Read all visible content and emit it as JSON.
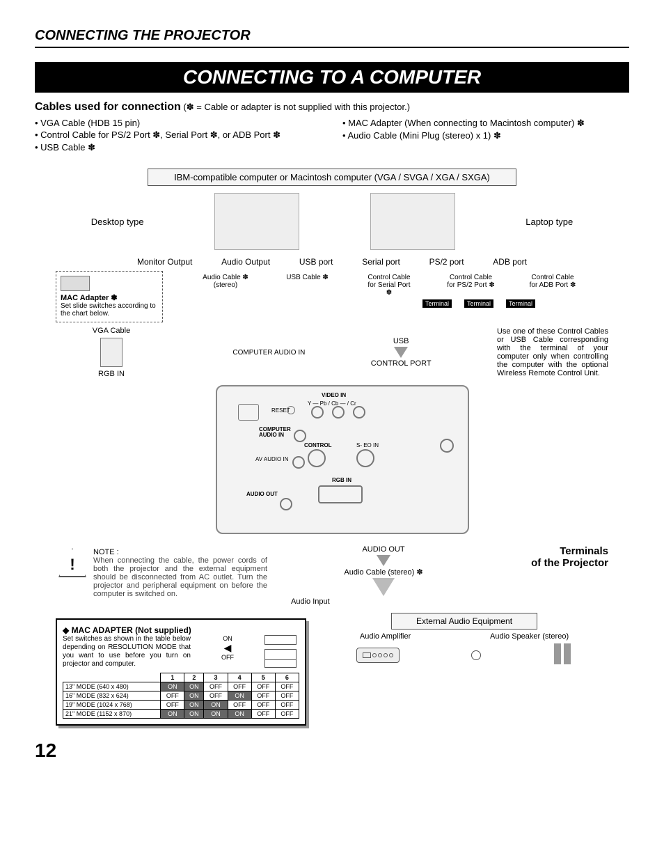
{
  "header": "CONNECTING THE PROJECTOR",
  "title": "CONNECTING TO A COMPUTER",
  "cables": {
    "heading": "Cables used for connection",
    "note_inline": "(✽ = Cable or adapter is not supplied with this projector.)",
    "left": [
      "• VGA Cable (HDB 15 pin)",
      "• Control Cable for PS/2 Port ✽, Serial Port ✽, or ADB Port ✽",
      "• USB Cable ✽"
    ],
    "right": [
      "• MAC Adapter (When connecting to Macintosh computer)  ✽",
      "• Audio Cable (Mini Plug (stereo) x 1) ✽"
    ]
  },
  "diagram": {
    "top_box": "IBM-compatible computer or Macintosh computer (VGA / SVGA / XGA / SXGA)",
    "desktop_label": "Desktop type",
    "laptop_label": "Laptop type",
    "ports": [
      "Monitor Output",
      "Audio Output",
      "USB port",
      "Serial port",
      "PS/2 port",
      "ADB port"
    ],
    "mac_adapter": {
      "title": "MAC Adapter ✽",
      "body": "Set slide switches according to the chart below."
    },
    "cable_col_labels": {
      "audio": "Audio Cable ✽ (stereo)",
      "usb": "USB Cable ✽",
      "serial": "Control Cable for Serial Port ✽",
      "ps2": "Control Cable for PS/2 Port ✽",
      "adb": "Control Cable for ADB Port ✽"
    },
    "terminal_tag": "Terminal",
    "vga_cable": "VGA Cable",
    "comp_audio_in": "COMPUTER AUDIO IN",
    "usb_label": "USB",
    "control_port": "CONTROL PORT",
    "rgb_in": "RGB IN",
    "side_text": "Use one of these Control Cables or USB Cable corresponding with the terminal of your computer only when controlling the computer with the optional Wireless Remote Control Unit.",
    "panel": {
      "video_in": "VIDEO IN",
      "ypbcr": "Y — Pb / Cb —     / Cr",
      "reset": "RESET",
      "computer_audio_in": "COMPUTER AUDIO IN",
      "control": "CONTROL",
      "svideo": "S-    EO IN",
      "av_audio_in": "AV AUDIO IN",
      "rgb_in": "RGB IN",
      "audio_out": "AUDIO OUT"
    },
    "audio_out": "AUDIO OUT",
    "audio_cable_stereo": "Audio Cable (stereo) ✽",
    "audio_input": "Audio Input",
    "terminals_label_1": "Terminals",
    "terminals_label_2": "of the Projector",
    "ext_audio": "External Audio Equipment",
    "audio_amp": "Audio Amplifier",
    "audio_spk": "Audio Speaker (stereo)"
  },
  "note": {
    "heading": "NOTE :",
    "body": "When connecting the cable, the power cords of both the projector and the external equipment should be disconnected from AC outlet.  Turn the projector and peripheral equipment on before the computer is switched on."
  },
  "mac_table": {
    "title": "◆ MAC ADAPTER (Not supplied)",
    "desc": "Set switches as shown in the table below depending on RESOLUTION MODE that you want to use before you turn on projector and computer.",
    "on": "ON",
    "off": "OFF",
    "cols": [
      "1",
      "2",
      "3",
      "4",
      "5",
      "6"
    ],
    "rows": [
      {
        "mode": "13\" MODE (640 x 480)",
        "sw": [
          "ON",
          "ON",
          "OFF",
          "OFF",
          "OFF",
          "OFF"
        ]
      },
      {
        "mode": "16\" MODE (832 x 624)",
        "sw": [
          "OFF",
          "ON",
          "OFF",
          "ON",
          "OFF",
          "OFF"
        ]
      },
      {
        "mode": "19\" MODE (1024 x 768)",
        "sw": [
          "OFF",
          "ON",
          "ON",
          "OFF",
          "OFF",
          "OFF"
        ]
      },
      {
        "mode": "21\" MODE (1152 x 870)",
        "sw": [
          "ON",
          "ON",
          "ON",
          "ON",
          "OFF",
          "OFF"
        ]
      }
    ]
  },
  "page_number": "12"
}
